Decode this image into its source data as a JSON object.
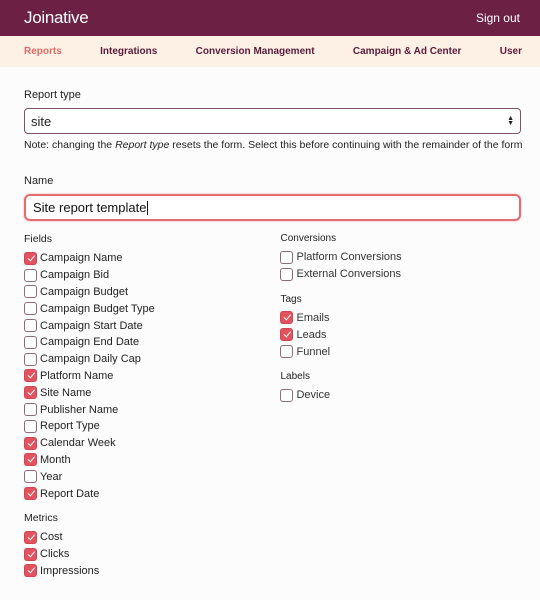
{
  "app": {
    "brand": "Joinative",
    "sign_out": "Sign out"
  },
  "nav": {
    "items": [
      {
        "label": "Reports",
        "active": true
      },
      {
        "label": "Integrations",
        "active": false
      },
      {
        "label": "Conversion Management",
        "active": false
      },
      {
        "label": "Campaign & Ad Center",
        "active": false
      },
      {
        "label": "User",
        "active": false
      }
    ]
  },
  "form": {
    "report_type_label": "Report type",
    "report_type_value": "site",
    "note_prefix": "Note: changing the ",
    "note_emphasis": "Report type",
    "note_suffix": " resets the form. Select this before continuing with the remainder of the form",
    "name_label": "Name",
    "name_value": "Site report template",
    "fields_title": "Fields",
    "fields": [
      {
        "label": "Campaign Name",
        "checked": true
      },
      {
        "label": "Campaign Bid",
        "checked": false
      },
      {
        "label": "Campaign Budget",
        "checked": false
      },
      {
        "label": "Campaign Budget Type",
        "checked": false
      },
      {
        "label": "Campaign Start Date",
        "checked": false
      },
      {
        "label": "Campaign End Date",
        "checked": false
      },
      {
        "label": "Campaign Daily Cap",
        "checked": false
      },
      {
        "label": "Platform Name",
        "checked": true
      },
      {
        "label": "Site Name",
        "checked": true
      },
      {
        "label": "Publisher Name",
        "checked": false
      },
      {
        "label": "Report Type",
        "checked": false
      },
      {
        "label": "Calendar Week",
        "checked": true
      },
      {
        "label": "Month",
        "checked": true
      },
      {
        "label": "Year",
        "checked": false
      },
      {
        "label": "Report Date",
        "checked": true
      }
    ],
    "metrics_title": "Metrics",
    "metrics": [
      {
        "label": "Cost",
        "checked": true
      },
      {
        "label": "Clicks",
        "checked": true
      },
      {
        "label": "Impressions",
        "checked": true
      }
    ],
    "conversions_title": "Conversions",
    "conversions": [
      {
        "label": "Platform Conversions",
        "checked": false
      },
      {
        "label": "External Conversions",
        "checked": false
      }
    ],
    "tags_title": "Tags",
    "tags": [
      {
        "label": "Emails",
        "checked": true
      },
      {
        "label": "Leads",
        "checked": true
      },
      {
        "label": "Funnel",
        "checked": false
      }
    ],
    "labels_title": "Labels",
    "labels": [
      {
        "label": "Device",
        "checked": false
      }
    ]
  },
  "colors": {
    "brand": "#6b2044",
    "nav_bg": "#fdf1e6",
    "accent": "#e0545f",
    "active_nav": "#e26a6a"
  }
}
